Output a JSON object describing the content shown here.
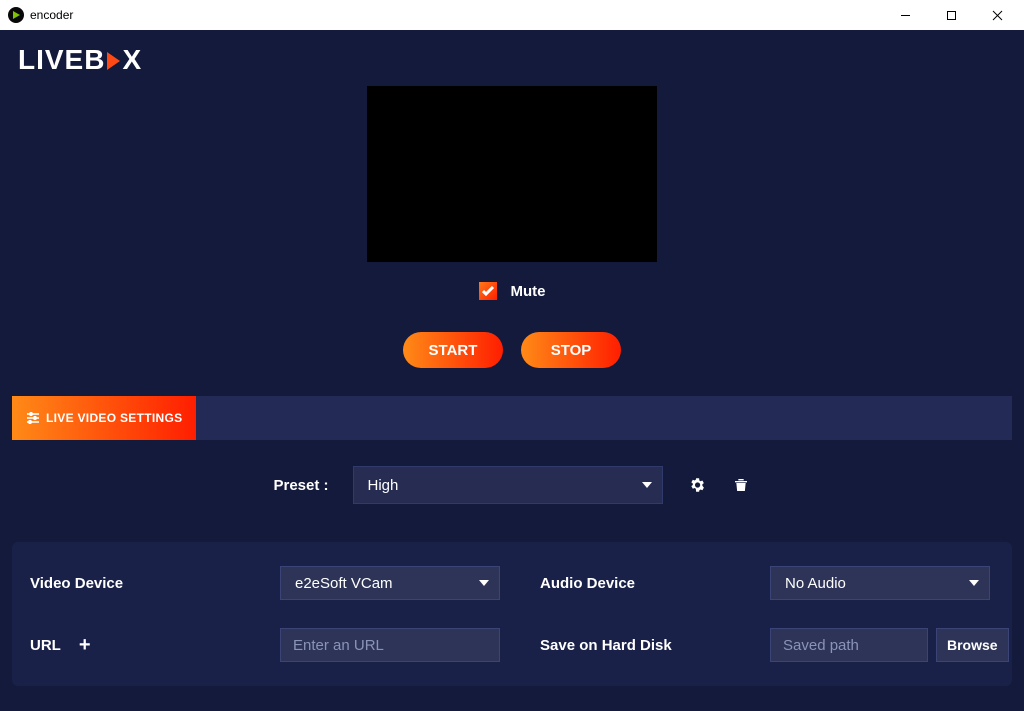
{
  "window": {
    "title": "encoder"
  },
  "logo": {
    "prefix": "LIVEB",
    "suffix": "X"
  },
  "mute": {
    "label": "Mute",
    "checked": true
  },
  "actions": {
    "start": "START",
    "stop": "STOP"
  },
  "tab": {
    "label": "LIVE VIDEO SETTINGS"
  },
  "preset": {
    "label": "Preset :",
    "value": "High"
  },
  "panel": {
    "video_device": {
      "label": "Video Device",
      "value": "e2eSoft VCam"
    },
    "audio_device": {
      "label": "Audio Device",
      "value": "No Audio"
    },
    "url": {
      "label": "URL",
      "placeholder": "Enter an URL",
      "add_icon": "+"
    },
    "save": {
      "label": "Save on Hard Disk",
      "placeholder": "Saved path",
      "browse": "Browse"
    }
  }
}
